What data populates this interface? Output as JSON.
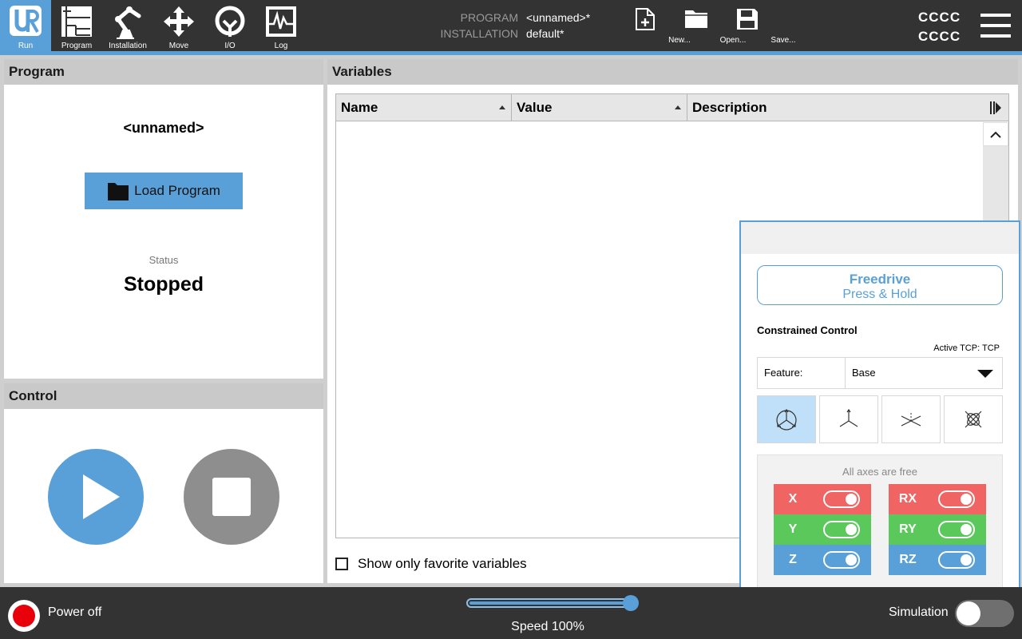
{
  "nav": {
    "tabs": [
      {
        "label": "Run",
        "icon": "ur-logo-icon"
      },
      {
        "label": "Program",
        "icon": "program-tree-icon"
      },
      {
        "label": "Installation",
        "icon": "robot-arm-icon"
      },
      {
        "label": "Move",
        "icon": "move-arrows-icon"
      },
      {
        "label": "I/O",
        "icon": "io-icon"
      },
      {
        "label": "Log",
        "icon": "log-icon"
      }
    ]
  },
  "program_info": {
    "program_key": "PROGRAM",
    "program_value": "<unnamed>*",
    "installation_key": "INSTALLATION",
    "installation_value": "default*"
  },
  "file_actions": {
    "new_label": "New...",
    "open_label": "Open...",
    "save_label": "Save..."
  },
  "user": {
    "line1": "CCCC",
    "line2": "CCCC"
  },
  "program_panel": {
    "title": "Program",
    "name": "<unnamed>",
    "load_label": "Load Program",
    "status_label": "Status",
    "status_value": "Stopped"
  },
  "control_panel": {
    "title": "Control"
  },
  "variables_panel": {
    "title": "Variables",
    "columns": {
      "name": "Name",
      "value": "Value",
      "description": "Description"
    },
    "favorite_label": "Show only favorite variables"
  },
  "freedrive": {
    "title": "Freedrive",
    "subtitle": "Press & Hold",
    "constrained_label": "Constrained Control",
    "tcp_label": "Active TCP:",
    "tcp_value": "TCP",
    "feature_label": "Feature:",
    "feature_value": "Base",
    "axes_title": "All axes are free",
    "axes": [
      {
        "label": "X",
        "color": "#f06464"
      },
      {
        "label": "Y",
        "color": "#5ac85a"
      },
      {
        "label": "Z",
        "color": "#5aa0d8"
      },
      {
        "label": "RX",
        "color": "#f06464"
      },
      {
        "label": "RY",
        "color": "#5ac85a"
      },
      {
        "label": "RZ",
        "color": "#5aa0d8"
      }
    ]
  },
  "bottom": {
    "power_label": "Power off",
    "speed_label": "Speed 100%",
    "speed_fraction": 1.0,
    "simulation_label": "Simulation"
  },
  "colors": {
    "accent": "#5aa0d8",
    "topbar": "#333333",
    "power_off": "#e8000a"
  }
}
